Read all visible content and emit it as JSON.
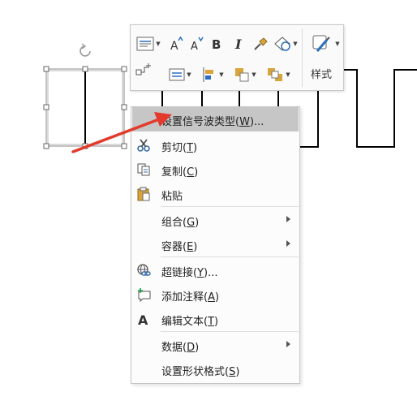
{
  "toolbar": {
    "style_label": "样式"
  },
  "menu": {
    "items": [
      {
        "pre": "设置信号波类型(",
        "key": "W",
        "post": ")...",
        "icon": "none",
        "submenu": false,
        "highlighted": true
      },
      {
        "pre": "剪切(",
        "key": "T",
        "post": ")",
        "icon": "scissors-icon",
        "submenu": false,
        "highlighted": false
      },
      {
        "pre": "复制(",
        "key": "C",
        "post": ")",
        "icon": "copy-icon",
        "submenu": false,
        "highlighted": false
      },
      {
        "pre": "粘贴",
        "key": "",
        "post": "",
        "icon": "clipboard-icon",
        "submenu": false,
        "highlighted": false
      },
      {
        "pre": "组合(",
        "key": "G",
        "post": ")",
        "icon": "none",
        "submenu": true,
        "highlighted": false
      },
      {
        "pre": "容器(",
        "key": "E",
        "post": ")",
        "icon": "none",
        "submenu": true,
        "highlighted": false
      },
      {
        "pre": "超链接(",
        "key": "Y",
        "post": ")...",
        "icon": "hyperlink-icon",
        "submenu": false,
        "highlighted": false
      },
      {
        "pre": "添加注释(",
        "key": "A",
        "post": ")",
        "icon": "comment-icon",
        "submenu": false,
        "highlighted": false
      },
      {
        "pre": "编辑文本(",
        "key": "T",
        "post": ")",
        "icon": "text-a-icon",
        "submenu": false,
        "highlighted": false
      },
      {
        "pre": "数据(",
        "key": "D",
        "post": ")",
        "icon": "none",
        "submenu": true,
        "highlighted": false
      },
      {
        "pre": "设置形状格式(",
        "key": "S",
        "post": ")",
        "icon": "none",
        "submenu": false,
        "highlighted": false
      }
    ]
  },
  "colors": {
    "highlight": "#c6c6c6",
    "arrow": "#e23b2e",
    "paste_yellow": "#d9a53a",
    "link_blue": "#3a6ea5",
    "accent_blue": "#2a6ebf"
  }
}
